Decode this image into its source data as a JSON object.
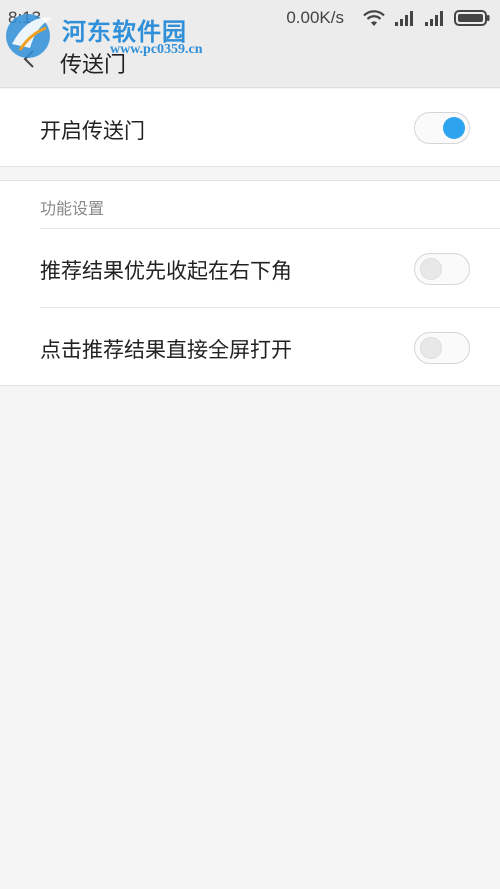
{
  "status_bar": {
    "time": "8:13",
    "network_speed": "0.00K/s",
    "icons": [
      "wifi-icon",
      "signal-icon",
      "signal-icon",
      "battery-icon"
    ]
  },
  "watermark": {
    "text": "河东软件园",
    "url": "www.pc0359.cn"
  },
  "header": {
    "back_icon": "chevron-left-icon",
    "title": "传送门"
  },
  "main_setting": {
    "label": "开启传送门",
    "enabled": true
  },
  "function_settings": {
    "section_title": "功能设置",
    "items": [
      {
        "label": "推荐结果优先收起在右下角",
        "enabled": false
      },
      {
        "label": "点击推荐结果直接全屏打开",
        "enabled": false
      }
    ]
  },
  "colors": {
    "accent": "#2fa4ee",
    "background": "#f5f5f5",
    "watermark": "#2f8fd8"
  }
}
